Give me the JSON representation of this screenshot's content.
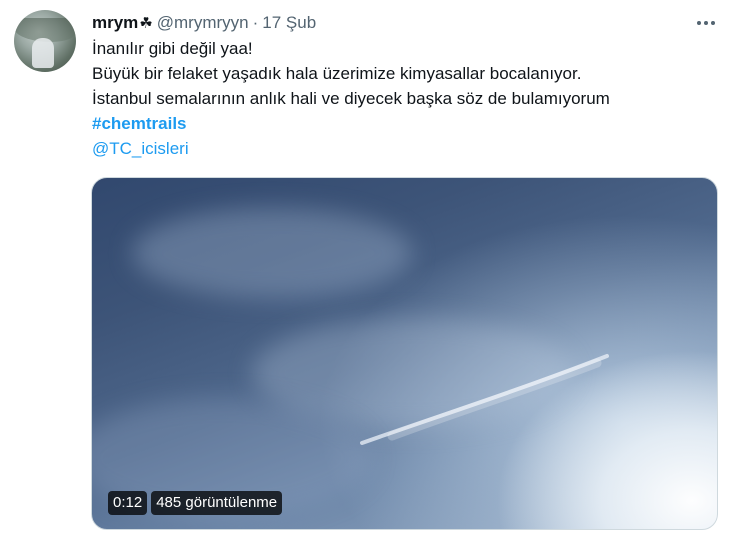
{
  "author": {
    "display_name": "mrym",
    "name_emoji": "☘",
    "handle": "@mrymryyn",
    "separator": "·",
    "time": "17 Şub"
  },
  "text": {
    "line1": "İnanılır gibi değil yaa!",
    "line2": "Büyük bir felaket yaşadık hala üzerimize kimyasallar bocalanıyor.",
    "line3": "İstanbul semalarının anlık hali ve diyecek başka söz de bulamıyorum",
    "hashtag": "#chemtrails",
    "mention": "@TC_icisleri"
  },
  "video": {
    "duration": "0:12",
    "views": "485 görüntülenme"
  },
  "icons": {
    "more": "more-horizontal-icon"
  },
  "colors": {
    "link": "#1d9bf0",
    "secondary_text": "#536471",
    "primary_text": "#0f1419"
  }
}
